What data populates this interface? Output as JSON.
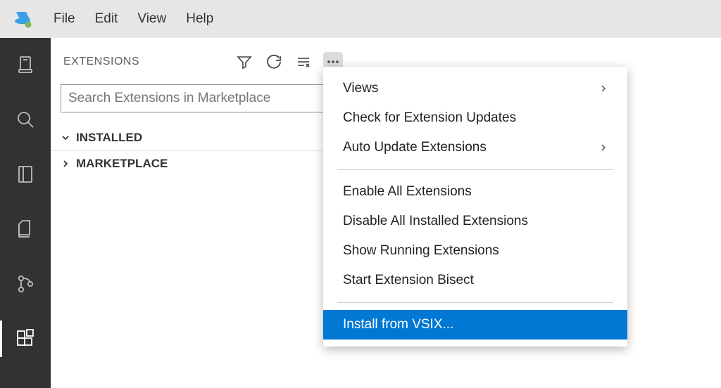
{
  "menubar": {
    "items": [
      "File",
      "Edit",
      "View",
      "Help"
    ]
  },
  "sidebar": {
    "title": "EXTENSIONS",
    "search_placeholder": "Search Extensions in Marketplace",
    "sections": {
      "installed": "INSTALLED",
      "marketplace": "MARKETPLACE"
    }
  },
  "context_menu": {
    "views": "Views",
    "check_updates": "Check for Extension Updates",
    "auto_update": "Auto Update Extensions",
    "enable_all": "Enable All Extensions",
    "disable_all": "Disable All Installed Extensions",
    "show_running": "Show Running Extensions",
    "start_bisect": "Start Extension Bisect",
    "install_vsix": "Install from VSIX..."
  }
}
